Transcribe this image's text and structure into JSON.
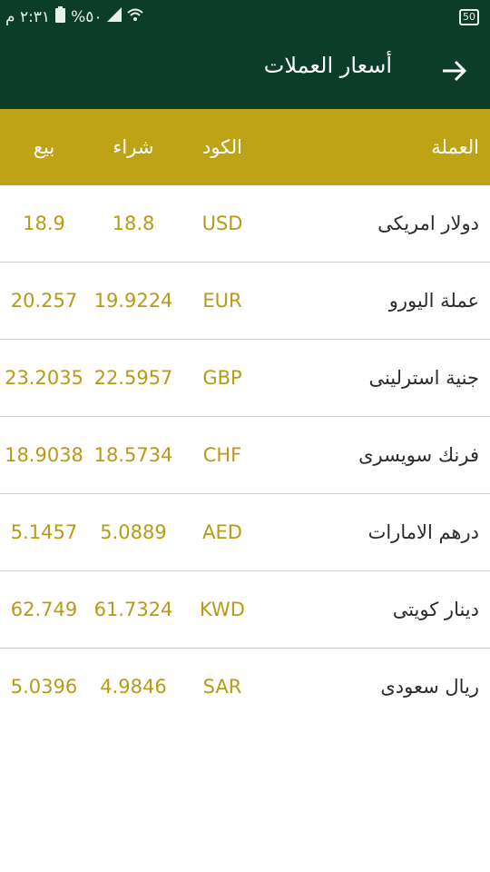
{
  "status_bar": {
    "time": "٢:٣١ م",
    "battery": "%٥٠",
    "battery_badge": "50"
  },
  "header": {
    "title": "أسعار العملات"
  },
  "table": {
    "columns": {
      "currency": "العملة",
      "code": "الكود",
      "buy": "شراء",
      "sell": "بيع"
    },
    "rows": [
      {
        "name": "دولار امريكى",
        "code": "USD",
        "buy": "18.8",
        "sell": "18.9"
      },
      {
        "name": "عملة اليورو",
        "code": "EUR",
        "buy": "19.9224",
        "sell": "20.257"
      },
      {
        "name": "جنية استرلينى",
        "code": "GBP",
        "buy": "22.5957",
        "sell": "23.2035"
      },
      {
        "name": "فرنك سويسرى",
        "code": "CHF",
        "buy": "18.5734",
        "sell": "18.9038"
      },
      {
        "name": "درهم الامارات",
        "code": "AED",
        "buy": "5.0889",
        "sell": "5.1457"
      },
      {
        "name": "دينار كويتى",
        "code": "KWD",
        "buy": "61.7324",
        "sell": "62.749"
      },
      {
        "name": "ريال سعودى",
        "code": "SAR",
        "buy": "4.9846",
        "sell": "5.0396"
      }
    ]
  },
  "colors": {
    "primary": "#0b3d2a",
    "accent": "#bfa317",
    "value_text": "#b79a16"
  }
}
